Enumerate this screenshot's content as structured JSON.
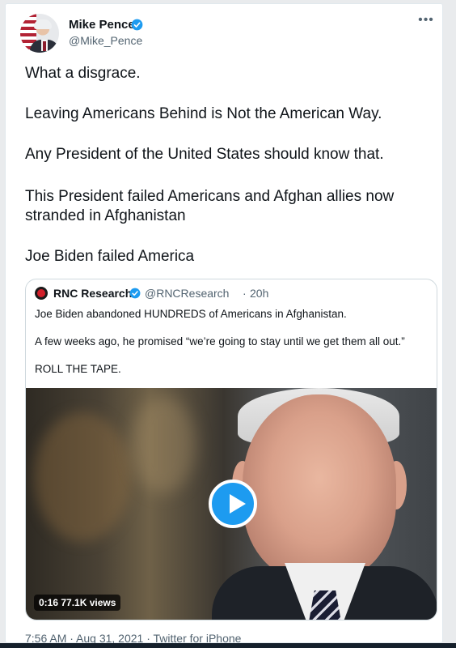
{
  "author": {
    "name": "Mike Pence",
    "handle": "@Mike_Pence",
    "verified": true,
    "avatar_icon": "user-avatar"
  },
  "more_icon": "more-horizontal-icon",
  "tweet_lines": [
    "What a disgrace.",
    "Leaving Americans Behind is Not the American Way.",
    "Any President of the United States should know that.",
    "This President failed Americans and Afghan allies now",
    "stranded in Afghanistan",
    "Joe Biden failed America"
  ],
  "quoted": {
    "name": "RNC Research",
    "handle": "@RNCResearch",
    "separator": "·",
    "time": "20h",
    "verified": true,
    "lines": [
      "Joe Biden abandoned HUNDREDS of Americans in Afghanistan.",
      "A few weeks ago, he promised “we’re going to stay until we get them all out.”",
      "ROLL THE TAPE."
    ],
    "video": {
      "duration": "0:16",
      "views": "77.1K views",
      "play_icon": "play-icon"
    }
  },
  "meta": "7:56 AM · Aug 31, 2021 · Twitter for iPhone",
  "colors": {
    "accent": "#1d9bf0",
    "text": "#0f1419",
    "secondary": "#536471",
    "border": "#cfd9de"
  }
}
